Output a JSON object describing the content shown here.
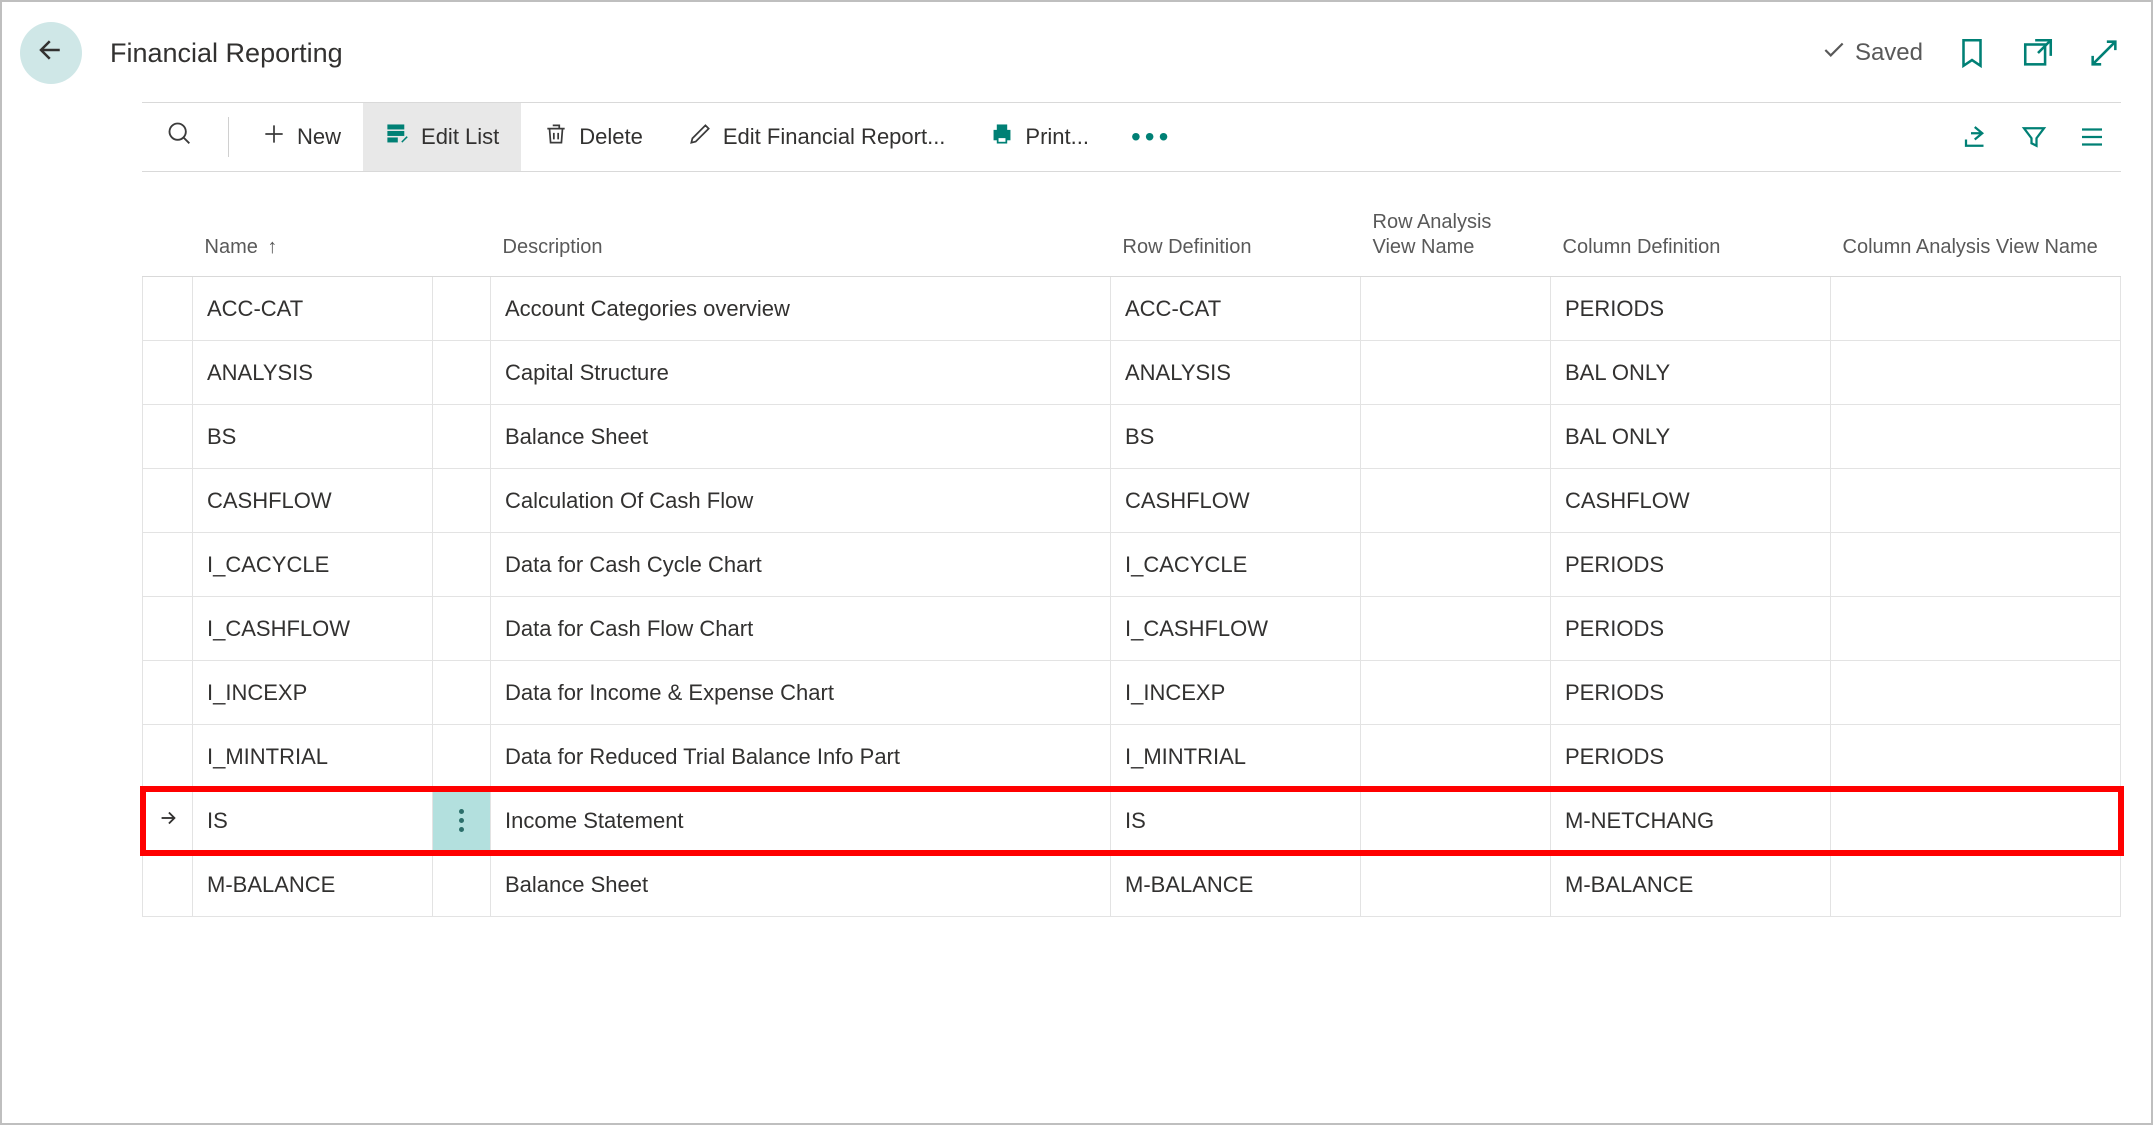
{
  "header": {
    "title": "Financial Reporting",
    "saved_label": "Saved"
  },
  "actions": {
    "new": "New",
    "edit_list": "Edit List",
    "delete": "Delete",
    "edit_report": "Edit Financial Report...",
    "print": "Print..."
  },
  "columns": {
    "name": "Name",
    "sort_indicator": "↑",
    "description": "Description",
    "row_definition": "Row Definition",
    "row_analysis": "Row Analysis View Name",
    "column_definition": "Column Definition",
    "column_analysis": "Column Analysis View Name"
  },
  "rows": [
    {
      "name": "ACC-CAT",
      "description": "Account Categories overview",
      "row_def": "ACC-CAT",
      "row_av": "",
      "col_def": "PERIODS",
      "col_av": "",
      "selected": false
    },
    {
      "name": "ANALYSIS",
      "description": "Capital Structure",
      "row_def": "ANALYSIS",
      "row_av": "",
      "col_def": "BAL ONLY",
      "col_av": "",
      "selected": false
    },
    {
      "name": "BS",
      "description": "Balance Sheet",
      "row_def": "BS",
      "row_av": "",
      "col_def": "BAL ONLY",
      "col_av": "",
      "selected": false
    },
    {
      "name": "CASHFLOW",
      "description": "Calculation Of Cash Flow",
      "row_def": "CASHFLOW",
      "row_av": "",
      "col_def": "CASHFLOW",
      "col_av": "",
      "selected": false
    },
    {
      "name": "I_CACYCLE",
      "description": "Data for Cash Cycle Chart",
      "row_def": "I_CACYCLE",
      "row_av": "",
      "col_def": "PERIODS",
      "col_av": "",
      "selected": false
    },
    {
      "name": "I_CASHFLOW",
      "description": "Data for Cash Flow Chart",
      "row_def": "I_CASHFLOW",
      "row_av": "",
      "col_def": "PERIODS",
      "col_av": "",
      "selected": false
    },
    {
      "name": "I_INCEXP",
      "description": "Data for Income & Expense Chart",
      "row_def": "I_INCEXP",
      "row_av": "",
      "col_def": "PERIODS",
      "col_av": "",
      "selected": false
    },
    {
      "name": "I_MINTRIAL",
      "description": "Data for Reduced Trial Balance Info Part",
      "row_def": "I_MINTRIAL",
      "row_av": "",
      "col_def": "PERIODS",
      "col_av": "",
      "selected": false
    },
    {
      "name": "IS",
      "description": "Income Statement",
      "row_def": "IS",
      "row_av": "",
      "col_def": "M-NETCHANG",
      "col_av": "",
      "selected": true
    },
    {
      "name": "M-BALANCE",
      "description": "Balance Sheet",
      "row_def": "M-BALANCE",
      "row_av": "",
      "col_def": "M-BALANCE",
      "col_av": "",
      "selected": false
    }
  ]
}
